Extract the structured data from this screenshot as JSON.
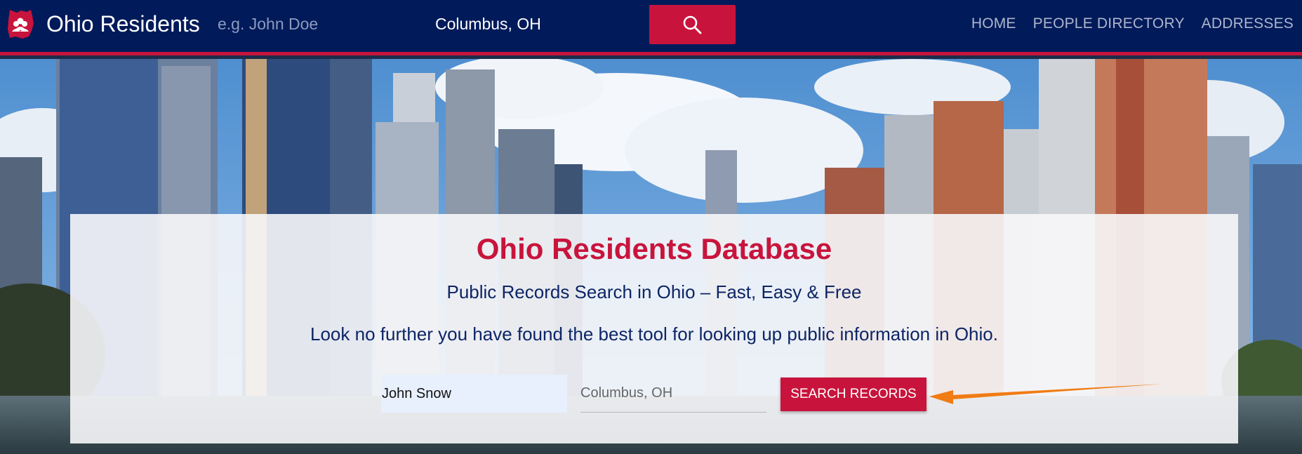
{
  "navbar": {
    "brand": "Ohio Residents",
    "logo_icon": "ohio-map-people-icon",
    "name_placeholder": "e.g. John Doe",
    "location_value": "Columbus, OH",
    "search_icon": "search-icon",
    "links": [
      "HOME",
      "PEOPLE DIRECTORY",
      "ADDRESSES"
    ]
  },
  "hero": {
    "title": "Ohio Residents Database",
    "subtitle": "Public Records Search in Ohio – Fast, Easy & Free",
    "description": "Look no further you have found the best tool for looking up public information in Ohio.",
    "name_value": "John Snow",
    "location_placeholder": "Columbus, OH",
    "search_button_label": "SEARCH RECORDS"
  },
  "colors": {
    "navbar": "#001a5a",
    "accent": "#c8143c",
    "text_dark_blue": "#0d2566",
    "arrow": "#f07c13"
  }
}
